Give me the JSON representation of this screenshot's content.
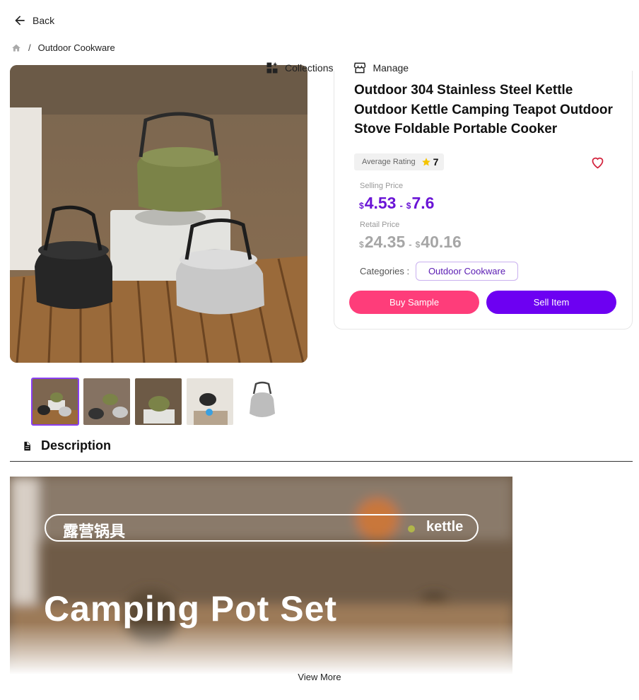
{
  "nav": {
    "back_label": "Back"
  },
  "breadcrumb": {
    "separator": "/",
    "current": "Outdoor Cookware"
  },
  "toolbar": {
    "collections_label": "Collections",
    "manage_label": "Manage"
  },
  "product": {
    "title": "Outdoor 304 Stainless Steel Kettle Outdoor Kettle Camping Teapot Outdoor Stove Foldable Portable Cooker",
    "rating_label": "Average Rating",
    "rating_value": "7",
    "selling_price_label": "Selling Price",
    "selling_price_min": "4.53",
    "selling_price_max": "7.6",
    "retail_price_label": "Retail Price",
    "retail_price_min": "24.35",
    "retail_price_max": "40.16",
    "currency": "$",
    "range_separator": "-",
    "categories_label": "Categories :",
    "category": "Outdoor Cookware",
    "buy_sample_label": "Buy Sample",
    "sell_item_label": "Sell Item"
  },
  "description": {
    "heading": "Description",
    "banner_tag_cn": "露营锅具",
    "banner_tag_en": "kettle",
    "banner_headline": "Camping Pot Set",
    "view_more_label": "View More"
  },
  "colors": {
    "selling_price": "#6a14d6",
    "buy_button": "#fe3d7a",
    "sell_button": "#6d00f2",
    "heart": "#d3223c",
    "star": "#f5c400"
  }
}
